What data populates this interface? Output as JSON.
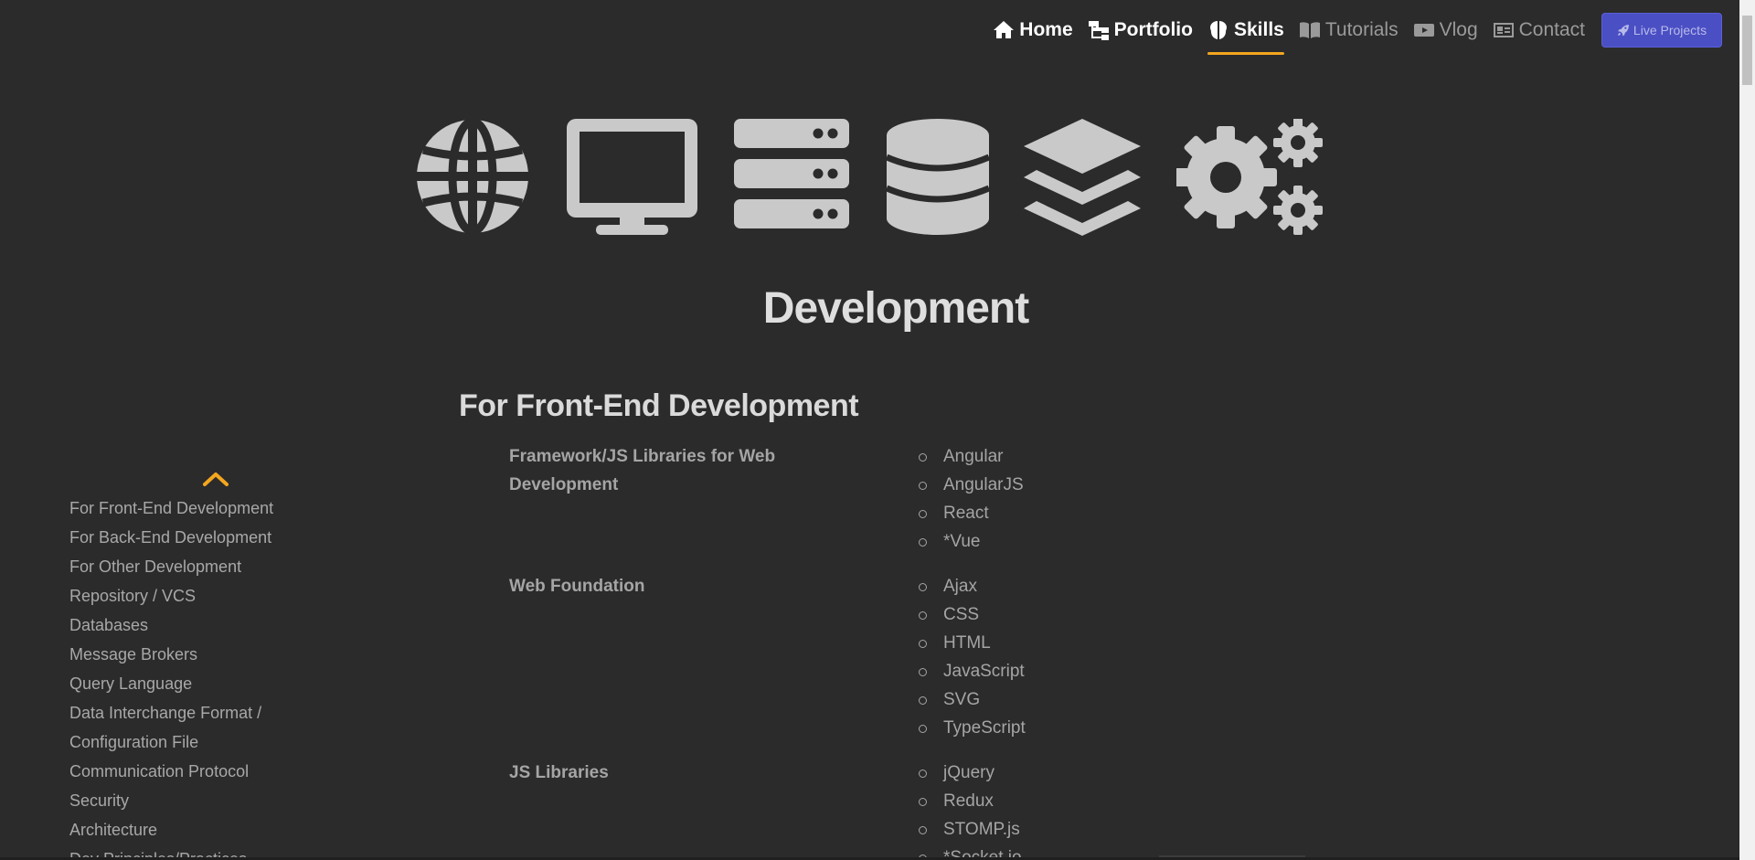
{
  "nav": {
    "items": [
      {
        "label": "Home",
        "icon": "home-icon"
      },
      {
        "label": "Portfolio",
        "icon": "sitemap-icon"
      },
      {
        "label": "Skills",
        "icon": "brain-icon",
        "active": true
      },
      {
        "label": "Tutorials",
        "icon": "book-icon"
      },
      {
        "label": "Vlog",
        "icon": "youtube-icon"
      },
      {
        "label": "Contact",
        "icon": "address-card-icon"
      }
    ],
    "live_button": "Live Projects",
    "live_icon": "rocket-icon",
    "accent_color": "#f4a61f",
    "button_color": "#4a4fc4"
  },
  "hero_icons": [
    "globe-icon",
    "desktop-icon",
    "server-icon",
    "database-icon",
    "layers-icon",
    "cogs-icon"
  ],
  "page_title": "Development",
  "sidenav": {
    "toggle_icon": "chevron-up-icon",
    "items": [
      "For Front-End Development",
      "For Back-End Development",
      "For Other Development",
      "Repository / VCS",
      "Databases",
      "Message Brokers",
      "Query Language",
      "Data Interchange Format /",
      "Configuration File",
      "Communication Protocol",
      "Security",
      "Architecture",
      "Dev Principles/Practices"
    ]
  },
  "main": {
    "section_title": "For Front-End Development",
    "categories": [
      {
        "label": "Framework/JS Libraries for Web Development",
        "skills": [
          "Angular",
          "AngularJS",
          "React",
          "*Vue"
        ]
      },
      {
        "label": "Web Foundation",
        "skills": [
          "Ajax",
          "CSS",
          "HTML",
          "JavaScript",
          "SVG",
          "TypeScript"
        ]
      },
      {
        "label": "JS Libraries",
        "skills": [
          "jQuery",
          "Redux",
          "STOMP.js",
          "*Socket.io"
        ]
      }
    ]
  }
}
